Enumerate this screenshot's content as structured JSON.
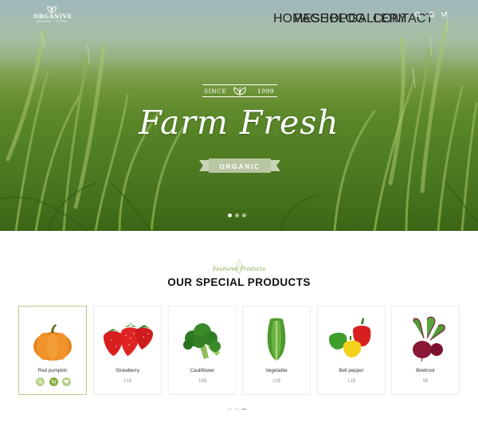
{
  "brand": {
    "name": "ORGANIVE",
    "tagline": "ORGANIC · STORE"
  },
  "nav": [
    "HOME",
    "PAGE",
    "SHOP",
    "BLOG",
    "GALLERY",
    "CONTACT"
  ],
  "header_icons": [
    "search-icon",
    "globe-icon",
    "cart-icon"
  ],
  "hero": {
    "since_label": "SINCE",
    "since_year": "1999",
    "headline": "Farm Fresh",
    "ribbon": "ORGANIC",
    "slides": 3,
    "active_slide": 1
  },
  "section": {
    "featured": "Featured Products",
    "title": "OUR SPECIAL PRODUCTS"
  },
  "products": [
    {
      "name": "Red pumpkin",
      "price": "",
      "image": "pumpkin",
      "active": true
    },
    {
      "name": "Strawberry",
      "price": "21$",
      "image": "strawberry",
      "active": false
    },
    {
      "name": "Cauliflower",
      "price": "19$",
      "image": "broccoli",
      "active": false
    },
    {
      "name": "Vegetable",
      "price": "23$",
      "image": "lettuce",
      "active": false
    },
    {
      "name": "Bell pepper",
      "price": "12$",
      "image": "bell-pepper",
      "active": false
    },
    {
      "name": "Beetroot",
      "price": "9$",
      "image": "beetroot",
      "active": false
    }
  ],
  "colors": {
    "accent": "#7fa93c",
    "accent_light": "#b6cf86",
    "title": "#111111"
  }
}
